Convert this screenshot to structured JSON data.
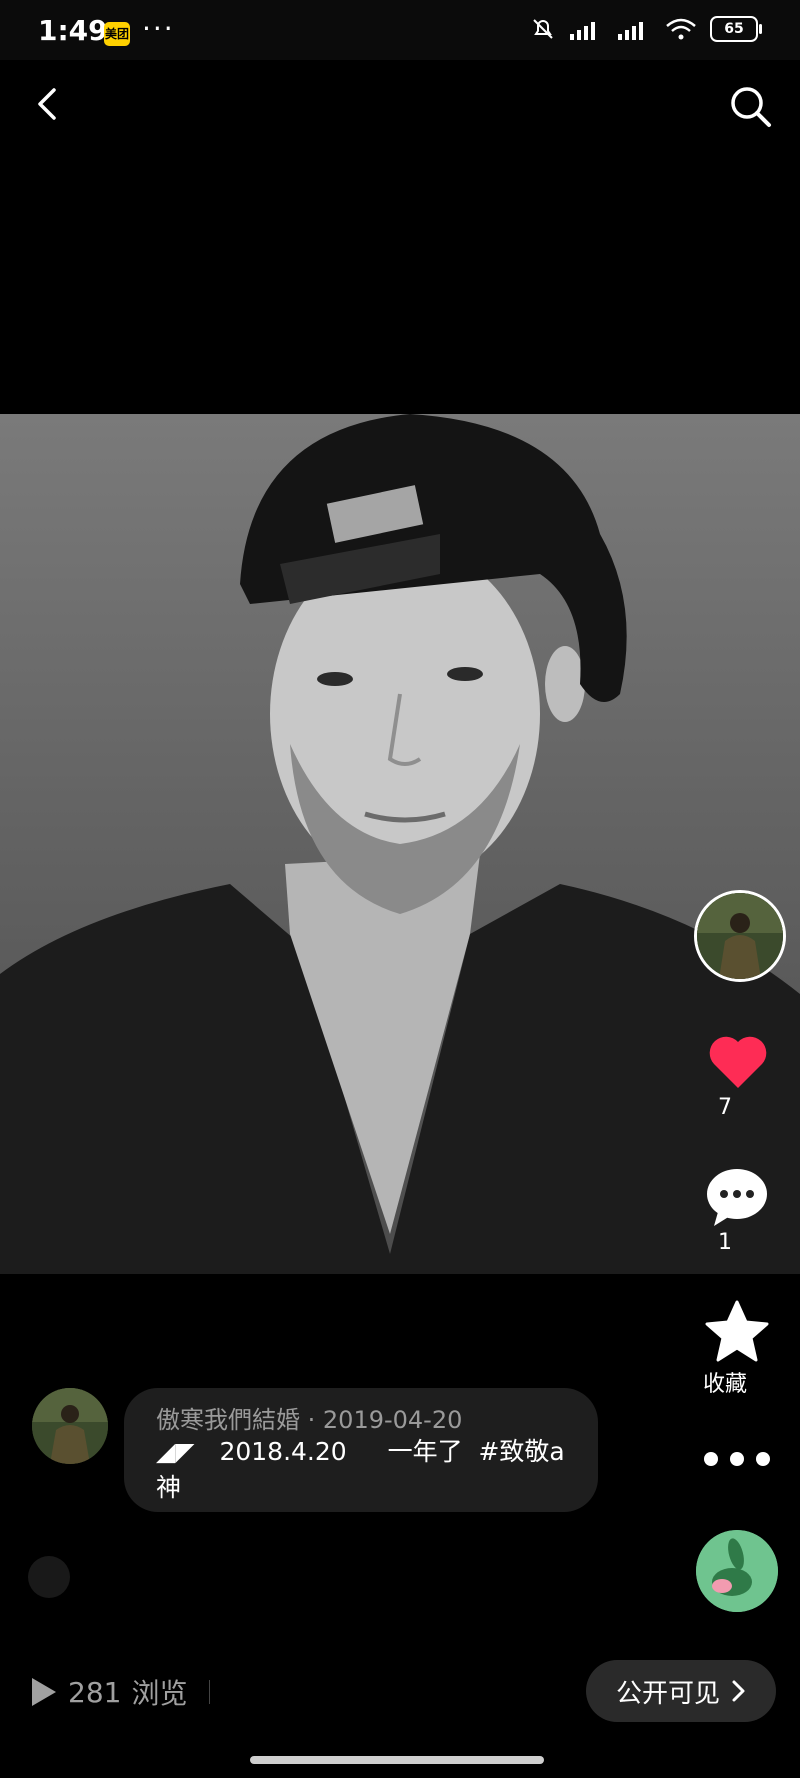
{
  "status_bar": {
    "time": "1:49",
    "app_badge": "美团",
    "more": "···",
    "battery": "65"
  },
  "nav": {
    "back_icon": "chevron-left-icon",
    "search_icon": "search-icon"
  },
  "rail": {
    "like_count": "7",
    "comment_count": "1",
    "favorite_label": "收藏"
  },
  "comment": {
    "author": "傲寒我們結婚",
    "date": "2019-04-20",
    "text": "◢◤　2018.4.20　  一年了  #致敬a神"
  },
  "bottom": {
    "views_count": "281",
    "views_label": "浏览",
    "visibility_label": "公开可见"
  },
  "colors": {
    "like": "#fe2c55",
    "background": "#000000",
    "bubble": "#1e1e1e",
    "meituan": "#ffd100"
  }
}
